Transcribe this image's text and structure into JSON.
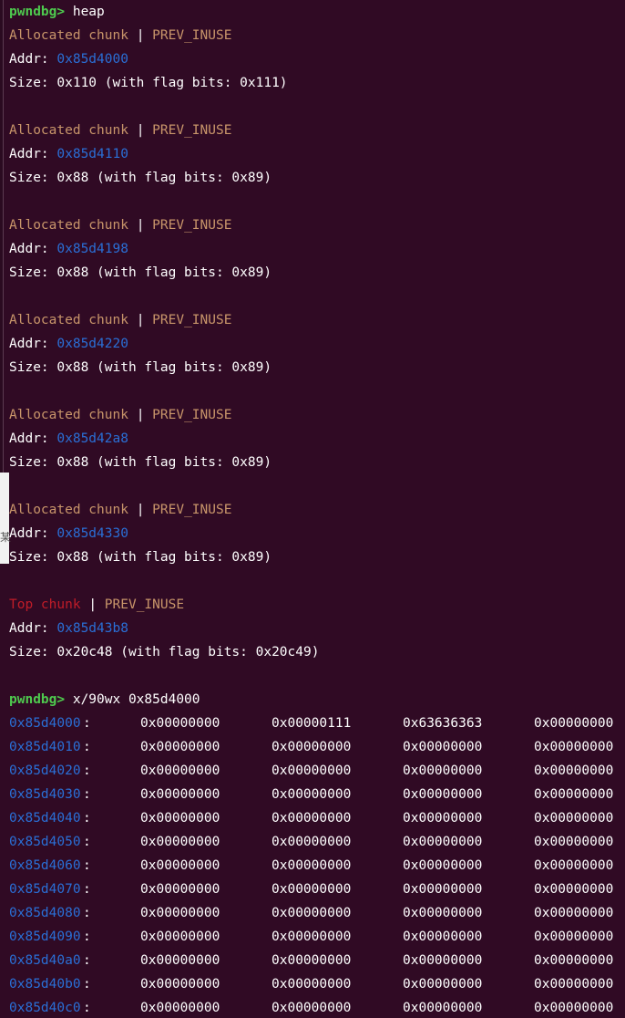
{
  "prompt": "pwndbg>",
  "commands": {
    "heap": "heap",
    "examine": "x/90wx 0x85d4000"
  },
  "labels": {
    "allocated": "Allocated chunk",
    "top": "Top chunk",
    "separator": "|",
    "prev_inuse": "PREV_INUSE",
    "addr": "Addr:"
  },
  "chunks": [
    {
      "addr": "0x85d4000",
      "size_text": "Size: 0x110 (with flag bits: 0x111)"
    },
    {
      "addr": "0x85d4110",
      "size_text": "Size: 0x88 (with flag bits: 0x89)"
    },
    {
      "addr": "0x85d4198",
      "size_text": "Size: 0x88 (with flag bits: 0x89)"
    },
    {
      "addr": "0x85d4220",
      "size_text": "Size: 0x88 (with flag bits: 0x89)"
    },
    {
      "addr": "0x85d42a8",
      "size_text": "Size: 0x88 (with flag bits: 0x89)"
    },
    {
      "addr": "0x85d4330",
      "size_text": "Size: 0x88 (with flag bits: 0x89)"
    }
  ],
  "top_chunk": {
    "addr": "0x85d43b8",
    "size_text": "Size: 0x20c48 (with flag bits: 0x20c49)"
  },
  "memory": [
    {
      "addr": "0x85d4000",
      "values": [
        "0x00000000",
        "0x00000111",
        "0x63636363",
        "0x00000000"
      ]
    },
    {
      "addr": "0x85d4010",
      "values": [
        "0x00000000",
        "0x00000000",
        "0x00000000",
        "0x00000000"
      ]
    },
    {
      "addr": "0x85d4020",
      "values": [
        "0x00000000",
        "0x00000000",
        "0x00000000",
        "0x00000000"
      ]
    },
    {
      "addr": "0x85d4030",
      "values": [
        "0x00000000",
        "0x00000000",
        "0x00000000",
        "0x00000000"
      ]
    },
    {
      "addr": "0x85d4040",
      "values": [
        "0x00000000",
        "0x00000000",
        "0x00000000",
        "0x00000000"
      ]
    },
    {
      "addr": "0x85d4050",
      "values": [
        "0x00000000",
        "0x00000000",
        "0x00000000",
        "0x00000000"
      ]
    },
    {
      "addr": "0x85d4060",
      "values": [
        "0x00000000",
        "0x00000000",
        "0x00000000",
        "0x00000000"
      ]
    },
    {
      "addr": "0x85d4070",
      "values": [
        "0x00000000",
        "0x00000000",
        "0x00000000",
        "0x00000000"
      ]
    },
    {
      "addr": "0x85d4080",
      "values": [
        "0x00000000",
        "0x00000000",
        "0x00000000",
        "0x00000000"
      ]
    },
    {
      "addr": "0x85d4090",
      "values": [
        "0x00000000",
        "0x00000000",
        "0x00000000",
        "0x00000000"
      ]
    },
    {
      "addr": "0x85d40a0",
      "values": [
        "0x00000000",
        "0x00000000",
        "0x00000000",
        "0x00000000"
      ]
    },
    {
      "addr": "0x85d40b0",
      "values": [
        "0x00000000",
        "0x00000000",
        "0x00000000",
        "0x00000000"
      ]
    },
    {
      "addr": "0x85d40c0",
      "values": [
        "0x00000000",
        "0x00000000",
        "0x00000000",
        "0x00000000"
      ]
    }
  ],
  "left_edge_glyph": "某"
}
